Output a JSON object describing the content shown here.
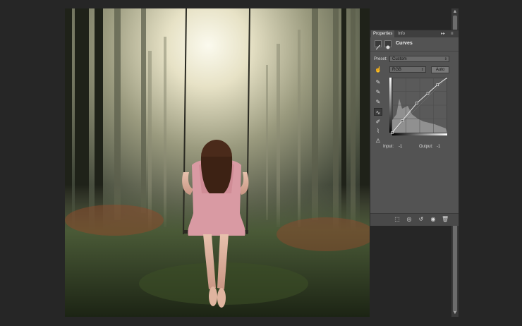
{
  "panel": {
    "tabs": [
      {
        "label": "Properties",
        "active": true
      },
      {
        "label": "Info",
        "active": false
      }
    ],
    "collapse_glyph": "▸▸",
    "menu_glyph": "≡",
    "header_icons": [
      "curves-adjustment-icon",
      "layer-mask-icon"
    ],
    "title": "Curves",
    "preset_label": "Preset:",
    "preset_value": "Custom",
    "channel_value": "RGB",
    "auto_label": "Auto",
    "input_label": "Input:",
    "input_value": "-1",
    "output_label": "Output:",
    "output_value": "-1",
    "tools": [
      {
        "name": "target-adjust-hand-icon",
        "glyph": "☝",
        "selected": false
      },
      {
        "name": "black-point-eyedropper-icon",
        "glyph": "✎",
        "selected": false
      },
      {
        "name": "gray-point-eyedropper-icon",
        "glyph": "✎",
        "selected": false
      },
      {
        "name": "white-point-eyedropper-icon",
        "glyph": "✎",
        "selected": false
      },
      {
        "name": "edit-points-curve-icon",
        "glyph": "∿",
        "selected": true
      },
      {
        "name": "draw-pencil-icon",
        "glyph": "✐",
        "selected": false
      },
      {
        "name": "smooth-curve-icon",
        "glyph": "⌇",
        "selected": false
      },
      {
        "name": "clipping-warning-icon",
        "glyph": "⚠",
        "selected": false
      }
    ],
    "footer_icons": [
      {
        "name": "clip-to-layer-icon",
        "glyph": "⬚"
      },
      {
        "name": "view-previous-state-icon",
        "glyph": "◎"
      },
      {
        "name": "reset-adjustment-icon",
        "glyph": "↺"
      },
      {
        "name": "toggle-visibility-icon",
        "glyph": "◉"
      },
      {
        "name": "delete-adjustment-icon",
        "glyph": "🗑"
      }
    ]
  },
  "curve": {
    "points": [
      [
        0,
        0
      ],
      [
        46,
        55
      ],
      [
        115,
        138
      ],
      [
        165,
        182
      ],
      [
        210,
        222
      ],
      [
        255,
        255
      ]
    ]
  },
  "colors": {
    "panel_bg": "#535353",
    "canvas_bg": "#262626",
    "dress": "#d99aa3",
    "hair": "#4a2a1a",
    "forest_fog": "#f2efd9"
  }
}
